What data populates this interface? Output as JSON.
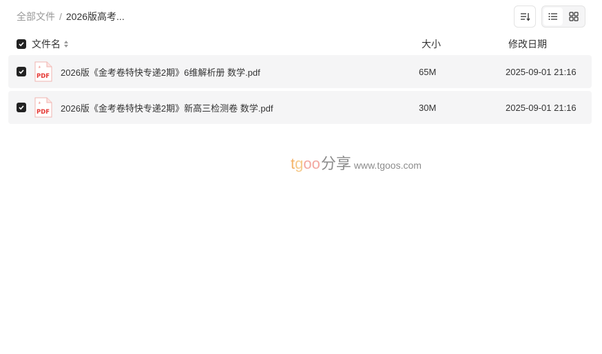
{
  "breadcrumb": {
    "root": "全部文件",
    "separator": "/",
    "current": "2026版高考..."
  },
  "toolbar": {
    "sort_icon": "sort-icon",
    "list_view_icon": "list-view-icon",
    "grid_view_icon": "grid-view-icon",
    "active_view": "list"
  },
  "table": {
    "header": {
      "name": "文件名",
      "size": "大小",
      "date": "修改日期",
      "select_all_checked": true
    },
    "rows": [
      {
        "checked": true,
        "icon": "pdf-file-icon",
        "name": "2026版《金考卷特快专递2期》6维解析册 数学.pdf",
        "size": "65M",
        "date": "2025-09-01 21:16"
      },
      {
        "checked": true,
        "icon": "pdf-file-icon",
        "name": "2026版《金考卷特快专递2期》新高三检测卷 数学.pdf",
        "size": "30M",
        "date": "2025-09-01 21:16"
      }
    ]
  },
  "watermark": {
    "t": "t",
    "g": "g",
    "oo": "oo",
    "share": "分享",
    "url": "www.tgoos.com"
  },
  "colors": {
    "row_bg": "#f5f5f6",
    "checkbox": "#222222",
    "pdf_red": "#e53935",
    "muted_text": "#999999"
  }
}
